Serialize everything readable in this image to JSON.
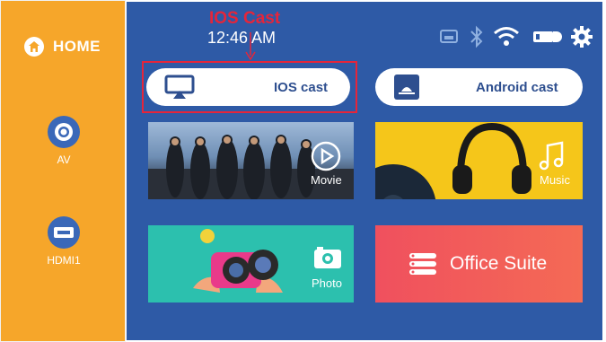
{
  "sidebar": {
    "home_label": "HOME",
    "items": [
      {
        "label": "AV"
      },
      {
        "label": "HDMI1"
      }
    ]
  },
  "header": {
    "time": "12:46 AM",
    "status_icons": [
      "ethernet-icon",
      "bluetooth-icon",
      "wifi-icon",
      "battery-icon",
      "gear-icon"
    ]
  },
  "annotation": {
    "label": "IOS Cast"
  },
  "cast": {
    "ios_label": "IOS cast",
    "android_label": "Android cast"
  },
  "tiles": {
    "movie": "Movie",
    "music": "Music",
    "photo": "Photo",
    "office": "Office Suite"
  },
  "colors": {
    "sidebar": "#f6a62a",
    "main": "#2e5aa6",
    "annotation": "#e5253a",
    "music_tile": "#f5c61a",
    "photo_tile": "#2cc0ae",
    "office_tile": "#f0505e"
  }
}
